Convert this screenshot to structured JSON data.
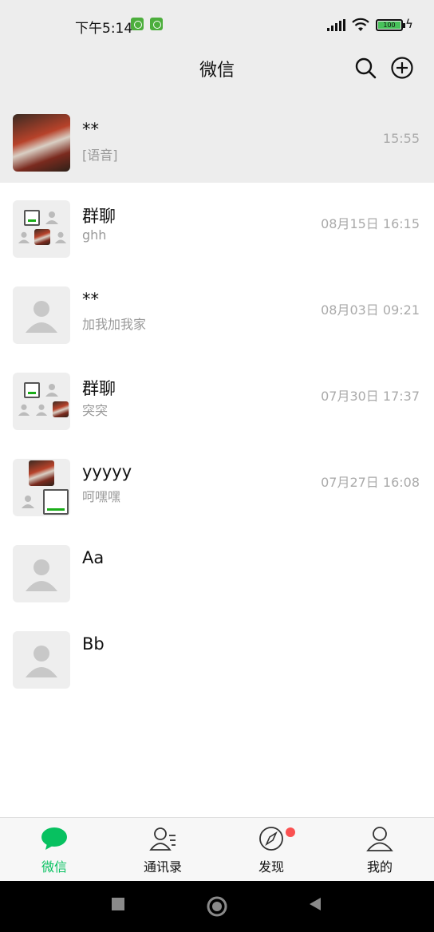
{
  "status_bar": {
    "time": "下午5:14",
    "battery": "100"
  },
  "header": {
    "title": "微信"
  },
  "chats": [
    {
      "name": "**",
      "preview": "[语音]",
      "time": "15:55"
    },
    {
      "name": "群聊",
      "preview": "ghh",
      "time": "08月15日 16:15"
    },
    {
      "name": "**",
      "preview": "加我加我家",
      "time": "08月03日 09:21"
    },
    {
      "name": "群聊",
      "preview": "突突",
      "time": "07月30日 17:37"
    },
    {
      "name": "yyyyy",
      "preview": "呵嘿嘿",
      "time": "07月27日 16:08"
    },
    {
      "name": "Aa",
      "preview": "",
      "time": ""
    },
    {
      "name": "Bb",
      "preview": "",
      "time": ""
    }
  ],
  "tabs": [
    {
      "label": "微信",
      "icon": "chat-bubble-icon",
      "active": true
    },
    {
      "label": "通讯录",
      "icon": "contacts-icon",
      "active": false
    },
    {
      "label": "发现",
      "icon": "compass-icon",
      "active": false
    },
    {
      "label": "我的",
      "icon": "person-icon",
      "active": false
    }
  ],
  "colors": {
    "accent": "#07c160",
    "header_bg": "#ededed",
    "badge": "#fa5151"
  }
}
